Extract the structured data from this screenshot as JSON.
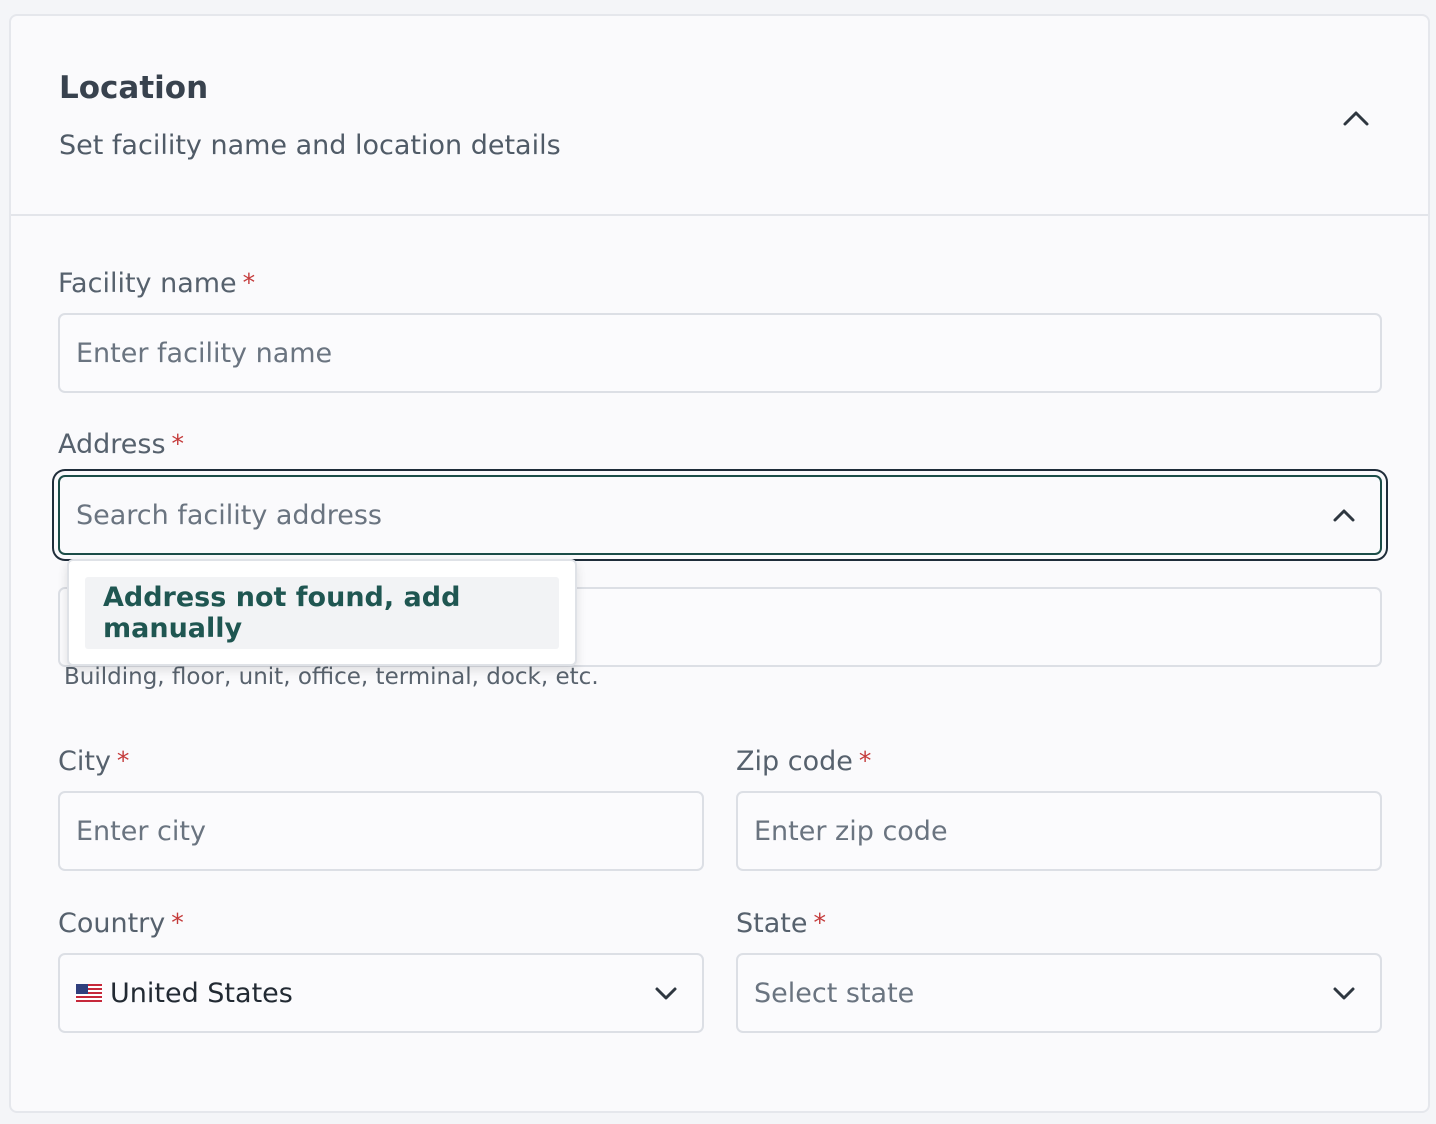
{
  "section": {
    "title": "Location",
    "subtitle": "Set facility name and location details"
  },
  "fields": {
    "facility_name": {
      "label": "Facility name",
      "required_mark": "*",
      "placeholder": "Enter facility name",
      "value": ""
    },
    "address": {
      "label": "Address",
      "required_mark": "*",
      "placeholder": "Search facility address",
      "value": ""
    },
    "address_line2": {
      "hint": "Building, floor, unit, office, terminal, dock, etc."
    },
    "city": {
      "label": "City",
      "required_mark": "*",
      "placeholder": "Enter city",
      "value": ""
    },
    "zip_code": {
      "label": "Zip code",
      "required_mark": "*",
      "placeholder": "Enter zip code",
      "value": ""
    },
    "country": {
      "label": "Country",
      "required_mark": "*",
      "value": "United States",
      "flag_icon": "us-flag-icon"
    },
    "state": {
      "label": "State",
      "required_mark": "*",
      "placeholder": "Select state"
    }
  },
  "address_dropdown": {
    "options": [
      "Address not found, add manually"
    ]
  },
  "colors": {
    "accent": "#1f5651",
    "required": "#c43a3a",
    "focus_border": "#1b4d48"
  }
}
